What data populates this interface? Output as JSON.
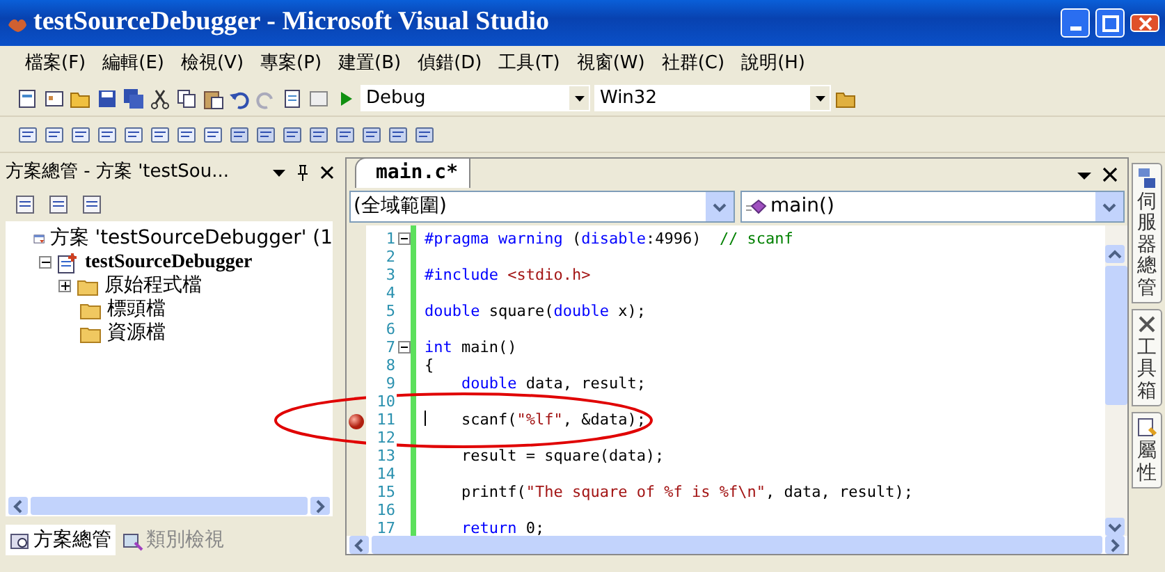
{
  "window": {
    "title": "testSourceDebugger - Microsoft Visual Studio"
  },
  "menu": [
    {
      "label": "檔案(F)"
    },
    {
      "label": "編輯(E)"
    },
    {
      "label": "檢視(V)"
    },
    {
      "label": "專案(P)"
    },
    {
      "label": "建置(B)"
    },
    {
      "label": "偵錯(D)"
    },
    {
      "label": "工具(T)"
    },
    {
      "label": "視窗(W)"
    },
    {
      "label": "社群(C)"
    },
    {
      "label": "說明(H)"
    }
  ],
  "toolbar": {
    "configuration": "Debug",
    "platform": "Win32"
  },
  "solution_explorer": {
    "title": "方案總管 - 方案 'testSou...",
    "tree": [
      {
        "label": "方案 'testSourceDebugger' (1",
        "kind": "solution",
        "children": [
          {
            "label": "testSourceDebugger",
            "kind": "project",
            "expanded": true,
            "children": [
              {
                "label": "原始程式檔",
                "kind": "folder",
                "expanded": false
              },
              {
                "label": "標頭檔",
                "kind": "folder"
              },
              {
                "label": "資源檔",
                "kind": "folder"
              }
            ]
          }
        ]
      }
    ],
    "tabs": [
      {
        "label": "方案總管",
        "selected": true
      },
      {
        "label": "類別檢視",
        "selected": false
      }
    ]
  },
  "editor": {
    "tabs": [
      {
        "label": "main.c*",
        "selected": true
      }
    ],
    "scope": "(全域範圍)",
    "member": "main()",
    "lines": [
      {
        "number": "1",
        "fold": true,
        "tokens": [
          {
            "kind": "keyword",
            "text": "#pragma warning"
          },
          {
            "kind": "plain",
            "text": " ("
          },
          {
            "kind": "keyword",
            "text": "disable"
          },
          {
            "kind": "plain",
            "text": ":4996)  "
          },
          {
            "kind": "comment",
            "text": "// scanf"
          }
        ]
      },
      {
        "number": "2"
      },
      {
        "number": "3",
        "tokens": [
          {
            "kind": "keyword",
            "text": "#include"
          },
          {
            "kind": "string",
            "text": "<stdio.h>",
            "space_before": true
          }
        ]
      },
      {
        "number": "4"
      },
      {
        "number": "5",
        "tokens": [
          {
            "kind": "keyword",
            "text": "double"
          },
          {
            "kind": "plain",
            "text": " square("
          },
          {
            "kind": "keyword",
            "text": "double"
          },
          {
            "kind": "plain",
            "text": " x);"
          }
        ]
      },
      {
        "number": "6"
      },
      {
        "number": "7",
        "fold": true,
        "tokens": [
          {
            "kind": "keyword",
            "text": "int"
          },
          {
            "kind": "plain",
            "text": " main()"
          }
        ]
      },
      {
        "number": "8",
        "tokens": [
          {
            "kind": "plain",
            "text": "{"
          }
        ]
      },
      {
        "number": "9",
        "indented": true,
        "tokens": [
          {
            "kind": "keyword",
            "text": "double"
          },
          {
            "kind": "plain",
            "text": " data, result;"
          }
        ]
      },
      {
        "number": "10"
      },
      {
        "number": "11",
        "breakpoint": true,
        "caret": true,
        "indented": true,
        "tokens": [
          {
            "kind": "plain",
            "text": "scanf("
          },
          {
            "kind": "string",
            "text": "\"%lf\""
          },
          {
            "kind": "plain",
            "text": ", &data);"
          }
        ]
      },
      {
        "number": "12"
      },
      {
        "number": "13",
        "indented": true,
        "tokens": [
          {
            "kind": "plain",
            "text": "result = square(data);"
          }
        ]
      },
      {
        "number": "14"
      },
      {
        "number": "15",
        "indented": true,
        "tokens": [
          {
            "kind": "plain",
            "text": "printf("
          },
          {
            "kind": "string",
            "text": "\"The square of %f is %f\\n\""
          },
          {
            "kind": "plain",
            "text": ", data, result);"
          }
        ]
      },
      {
        "number": "16"
      },
      {
        "number": "17",
        "indented": true,
        "tokens": [
          {
            "kind": "keyword",
            "text": "return"
          },
          {
            "kind": "plain",
            "text": " 0;"
          }
        ]
      }
    ]
  },
  "side_tabs": [
    {
      "label": "伺服器總管"
    },
    {
      "label": "工具箱"
    },
    {
      "label": "屬性"
    }
  ]
}
